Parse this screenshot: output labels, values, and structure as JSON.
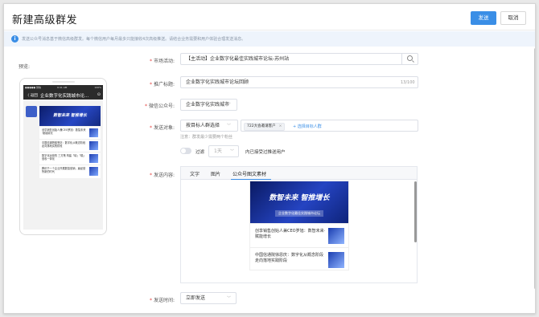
{
  "header": {
    "title": "新建高级群发",
    "send_label": "发送",
    "cancel_label": "取消"
  },
  "notice": {
    "text": "发送公众号消息基于微信高级群发。每个微信用户每月最多只能接收4次高级推送。请结合业务需要和用户体验合理发送消息。"
  },
  "preview": {
    "label": "预览:",
    "status_left": "●●●●● 微信",
    "status_time": "9:41 AM",
    "status_right": "100%",
    "back_label": "〈 返回",
    "nav_title": "企业数字化实践城市论...",
    "menu_label": "⊙",
    "banner_text": "数智未来 智推增长",
    "items": [
      "创享销售创始人兼CEO罗旭：数智未来·赋能增长",
      "中国信通院徐恩庆：数字化从概念阶段走向落地实践阶段",
      "数字化运营的 三方策 构建「增」「稳」营收一体化",
      "腾讯千一个企业开展数智营销，赢经营所新的时代"
    ]
  },
  "form": {
    "activity": {
      "label": "市场活动:",
      "value": "【主活动】企业数字化最佳实践城市论坛-苏州站"
    },
    "promo_title": {
      "label": "推广标题:",
      "value": "企业数字化实践城市论坛回顾",
      "counter": "13/100"
    },
    "official_account": {
      "label": "微信公众号:",
      "value": "企业数字化实践城市"
    },
    "target": {
      "label": "发送对象:",
      "select_value": "按目标人群选择",
      "tag": "722大会邀请客户",
      "tag_close": "×",
      "add_link": "+ 选择目标人群",
      "hint": "注意：群发最少需要两个粉丝"
    },
    "filter": {
      "label": "过滤",
      "days_value": "1天",
      "suffix": "内已接受过推送用户"
    },
    "content": {
      "label": "发送内容:",
      "tabs": [
        "文字",
        "图片",
        "公众号图文素材"
      ],
      "banner_title": "数智未来 智推增长",
      "banner_sub": "企业数字化最佳实践城市论坛",
      "articles": [
        "创享销售创始人兼CEO罗旭：数智未来·赋能增长",
        "中国信通院徐恩庆：数字化从概念阶段走向落地实践阶段"
      ]
    },
    "send_time": {
      "label": "发送时间:",
      "value": "立即发送"
    }
  },
  "colors": {
    "primary": "#3a8ee6",
    "required": "#e64340"
  }
}
